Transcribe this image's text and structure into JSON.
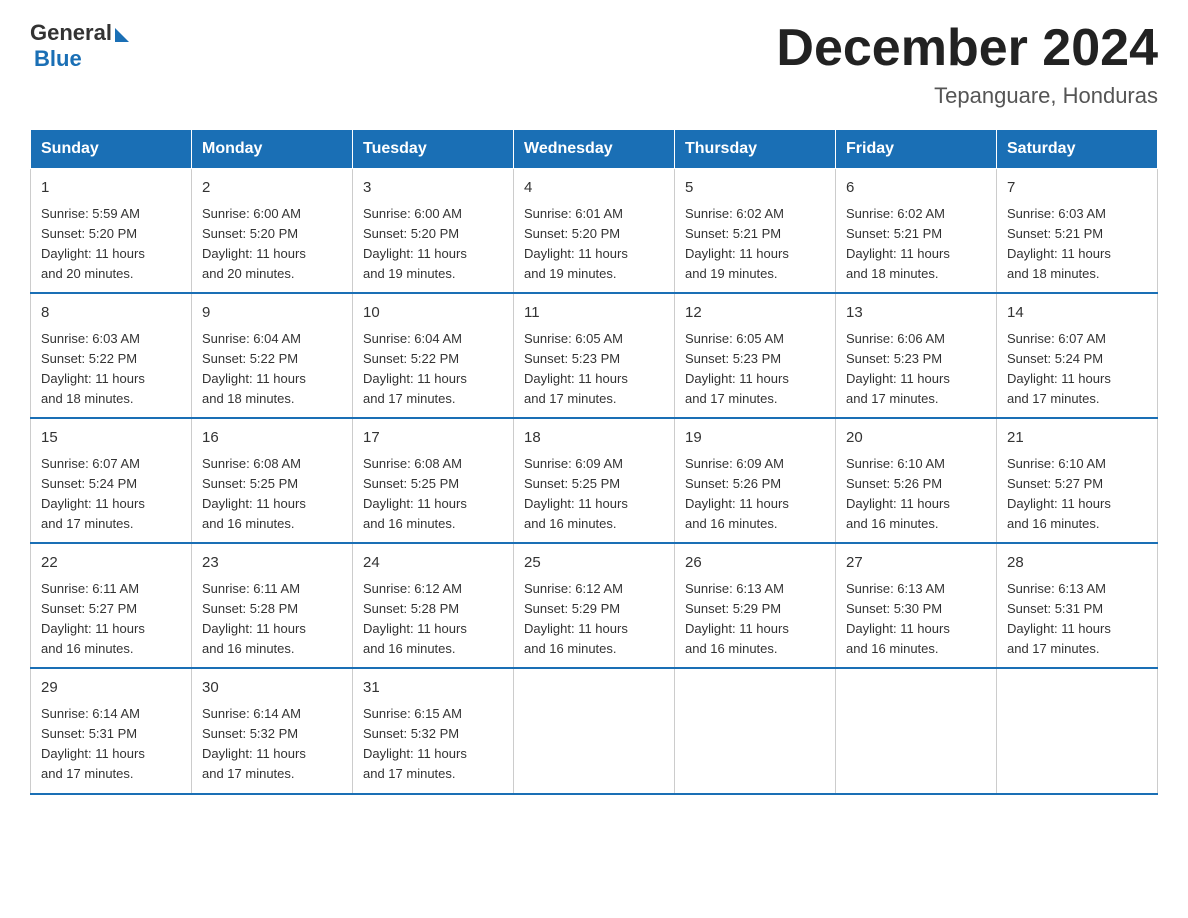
{
  "logo": {
    "general": "General",
    "blue": "Blue"
  },
  "title": "December 2024",
  "subtitle": "Tepanguare, Honduras",
  "days_header": [
    "Sunday",
    "Monday",
    "Tuesday",
    "Wednesday",
    "Thursday",
    "Friday",
    "Saturday"
  ],
  "weeks": [
    [
      {
        "day": "1",
        "sunrise": "5:59 AM",
        "sunset": "5:20 PM",
        "daylight": "11 hours and 20 minutes."
      },
      {
        "day": "2",
        "sunrise": "6:00 AM",
        "sunset": "5:20 PM",
        "daylight": "11 hours and 20 minutes."
      },
      {
        "day": "3",
        "sunrise": "6:00 AM",
        "sunset": "5:20 PM",
        "daylight": "11 hours and 19 minutes."
      },
      {
        "day": "4",
        "sunrise": "6:01 AM",
        "sunset": "5:20 PM",
        "daylight": "11 hours and 19 minutes."
      },
      {
        "day": "5",
        "sunrise": "6:02 AM",
        "sunset": "5:21 PM",
        "daylight": "11 hours and 19 minutes."
      },
      {
        "day": "6",
        "sunrise": "6:02 AM",
        "sunset": "5:21 PM",
        "daylight": "11 hours and 18 minutes."
      },
      {
        "day": "7",
        "sunrise": "6:03 AM",
        "sunset": "5:21 PM",
        "daylight": "11 hours and 18 minutes."
      }
    ],
    [
      {
        "day": "8",
        "sunrise": "6:03 AM",
        "sunset": "5:22 PM",
        "daylight": "11 hours and 18 minutes."
      },
      {
        "day": "9",
        "sunrise": "6:04 AM",
        "sunset": "5:22 PM",
        "daylight": "11 hours and 18 minutes."
      },
      {
        "day": "10",
        "sunrise": "6:04 AM",
        "sunset": "5:22 PM",
        "daylight": "11 hours and 17 minutes."
      },
      {
        "day": "11",
        "sunrise": "6:05 AM",
        "sunset": "5:23 PM",
        "daylight": "11 hours and 17 minutes."
      },
      {
        "day": "12",
        "sunrise": "6:05 AM",
        "sunset": "5:23 PM",
        "daylight": "11 hours and 17 minutes."
      },
      {
        "day": "13",
        "sunrise": "6:06 AM",
        "sunset": "5:23 PM",
        "daylight": "11 hours and 17 minutes."
      },
      {
        "day": "14",
        "sunrise": "6:07 AM",
        "sunset": "5:24 PM",
        "daylight": "11 hours and 17 minutes."
      }
    ],
    [
      {
        "day": "15",
        "sunrise": "6:07 AM",
        "sunset": "5:24 PM",
        "daylight": "11 hours and 17 minutes."
      },
      {
        "day": "16",
        "sunrise": "6:08 AM",
        "sunset": "5:25 PM",
        "daylight": "11 hours and 16 minutes."
      },
      {
        "day": "17",
        "sunrise": "6:08 AM",
        "sunset": "5:25 PM",
        "daylight": "11 hours and 16 minutes."
      },
      {
        "day": "18",
        "sunrise": "6:09 AM",
        "sunset": "5:25 PM",
        "daylight": "11 hours and 16 minutes."
      },
      {
        "day": "19",
        "sunrise": "6:09 AM",
        "sunset": "5:26 PM",
        "daylight": "11 hours and 16 minutes."
      },
      {
        "day": "20",
        "sunrise": "6:10 AM",
        "sunset": "5:26 PM",
        "daylight": "11 hours and 16 minutes."
      },
      {
        "day": "21",
        "sunrise": "6:10 AM",
        "sunset": "5:27 PM",
        "daylight": "11 hours and 16 minutes."
      }
    ],
    [
      {
        "day": "22",
        "sunrise": "6:11 AM",
        "sunset": "5:27 PM",
        "daylight": "11 hours and 16 minutes."
      },
      {
        "day": "23",
        "sunrise": "6:11 AM",
        "sunset": "5:28 PM",
        "daylight": "11 hours and 16 minutes."
      },
      {
        "day": "24",
        "sunrise": "6:12 AM",
        "sunset": "5:28 PM",
        "daylight": "11 hours and 16 minutes."
      },
      {
        "day": "25",
        "sunrise": "6:12 AM",
        "sunset": "5:29 PM",
        "daylight": "11 hours and 16 minutes."
      },
      {
        "day": "26",
        "sunrise": "6:13 AM",
        "sunset": "5:29 PM",
        "daylight": "11 hours and 16 minutes."
      },
      {
        "day": "27",
        "sunrise": "6:13 AM",
        "sunset": "5:30 PM",
        "daylight": "11 hours and 16 minutes."
      },
      {
        "day": "28",
        "sunrise": "6:13 AM",
        "sunset": "5:31 PM",
        "daylight": "11 hours and 17 minutes."
      }
    ],
    [
      {
        "day": "29",
        "sunrise": "6:14 AM",
        "sunset": "5:31 PM",
        "daylight": "11 hours and 17 minutes."
      },
      {
        "day": "30",
        "sunrise": "6:14 AM",
        "sunset": "5:32 PM",
        "daylight": "11 hours and 17 minutes."
      },
      {
        "day": "31",
        "sunrise": "6:15 AM",
        "sunset": "5:32 PM",
        "daylight": "11 hours and 17 minutes."
      },
      null,
      null,
      null,
      null
    ]
  ],
  "label_sunrise": "Sunrise:",
  "label_sunset": "Sunset:",
  "label_daylight": "Daylight:"
}
